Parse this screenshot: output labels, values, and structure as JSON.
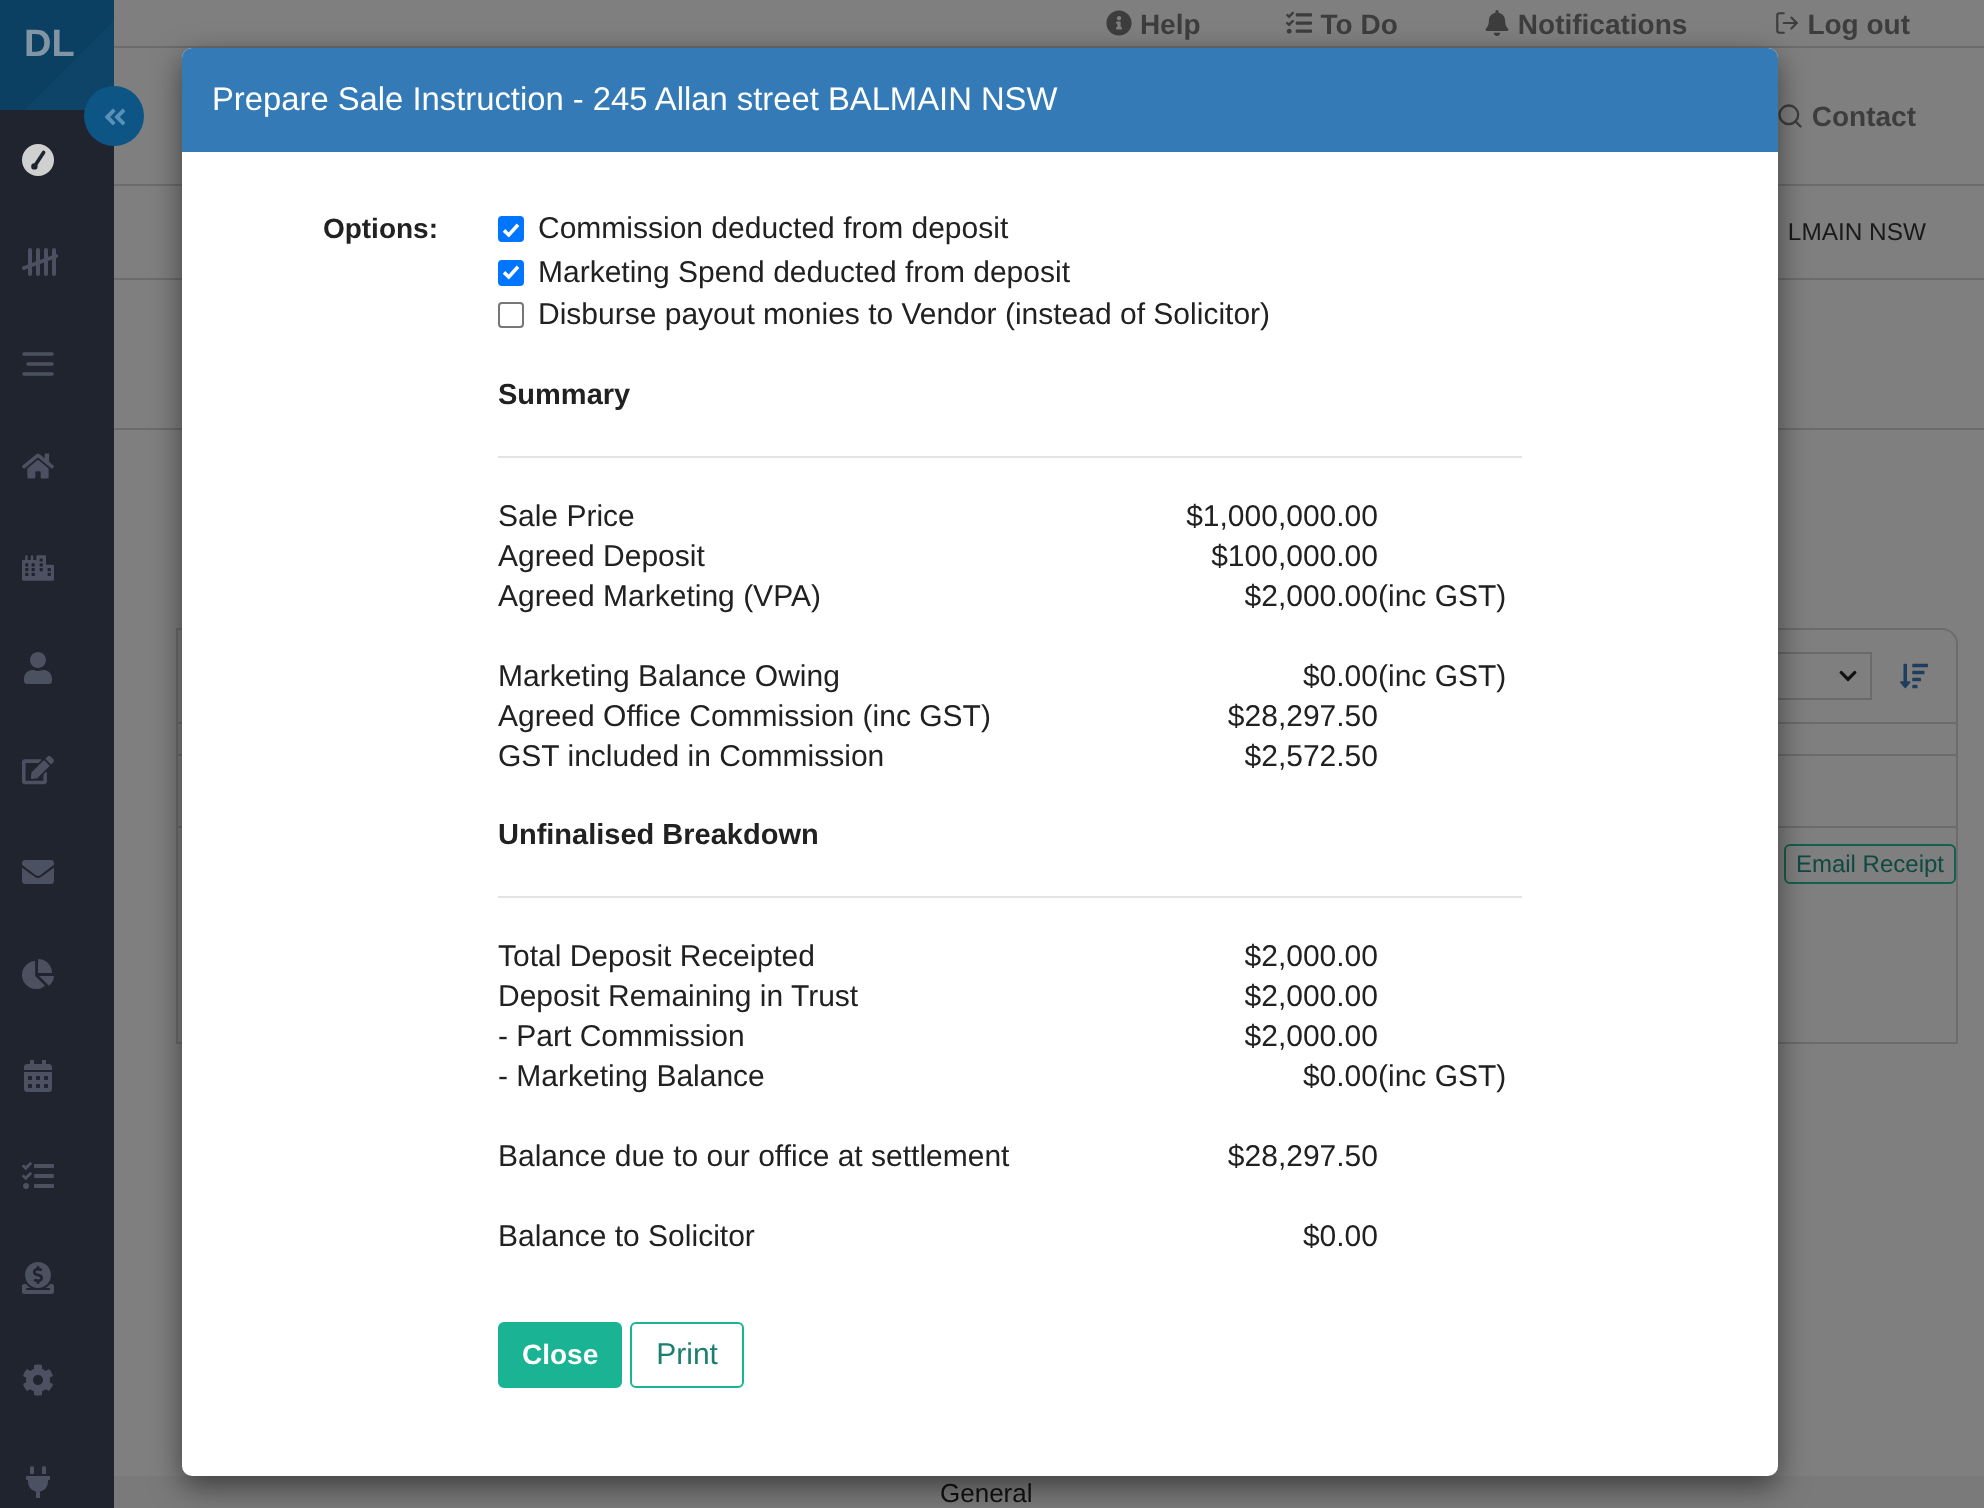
{
  "sidebar": {
    "logo": "DL",
    "items": [
      {
        "selected": true
      },
      {
        "selected": false
      },
      {
        "selected": false
      },
      {
        "selected": false
      },
      {
        "selected": false
      },
      {
        "selected": false
      },
      {
        "selected": false
      },
      {
        "selected": false
      },
      {
        "selected": false
      },
      {
        "selected": false
      },
      {
        "selected": false
      },
      {
        "selected": false
      },
      {
        "selected": false
      },
      {
        "selected": false
      }
    ]
  },
  "top_nav": [
    {
      "label": "Help"
    },
    {
      "label": "To Do"
    },
    {
      "label": "Notifications"
    },
    {
      "label": "Log out"
    }
  ],
  "search_link": {
    "label": "Contact"
  },
  "breadcrumb": "LMAIN NSW",
  "receipt_button": "Email Receipt",
  "bottom_tab": "General",
  "modal": {
    "title": "Prepare Sale Instruction - 245 Allan street BALMAIN NSW",
    "options_label": "Options:",
    "options": [
      {
        "label": "Commission deducted from deposit",
        "checked": true
      },
      {
        "label": "Marketing Spend deducted from deposit",
        "checked": true
      },
      {
        "label": "Disburse payout monies to Vendor (instead of Solicitor)",
        "checked": false
      }
    ],
    "sections": [
      {
        "heading": "Summary",
        "groups": [
          {
            "rows": [
              {
                "label": "Sale Price",
                "value": "$1,000,000.00"
              },
              {
                "label": "Agreed Deposit",
                "value": "$100,000.00"
              },
              {
                "label": "Agreed Marketing (VPA)",
                "value": "$2,000.00",
                "note": "(inc GST)"
              }
            ]
          },
          {
            "rows": [
              {
                "label": "Marketing Balance Owing",
                "value": "$0.00",
                "note": "(inc GST)"
              },
              {
                "label": "Agreed Office Commission (inc GST)",
                "value": "$28,297.50"
              },
              {
                "label": "GST included in Commission",
                "value": "$2,572.50"
              }
            ]
          }
        ]
      },
      {
        "heading": "Unfinalised Breakdown",
        "groups": [
          {
            "rows": [
              {
                "label": "Total Deposit Receipted",
                "value": "$2,000.00"
              },
              {
                "label": "Deposit Remaining in Trust",
                "value": "$2,000.00"
              },
              {
                "label": "- Part Commission",
                "value": "$2,000.00"
              },
              {
                "label": "- Marketing Balance",
                "value": "$0.00",
                "note": "(inc GST)"
              }
            ]
          },
          {
            "rows": [
              {
                "label": "Balance due to our office at settlement",
                "value": "$28,297.50"
              }
            ]
          },
          {
            "rows": [
              {
                "label": "Balance to Solicitor",
                "value": "$0.00"
              }
            ]
          }
        ]
      }
    ],
    "buttons": [
      {
        "label": "Close",
        "kind": "primary"
      },
      {
        "label": "Print",
        "kind": "outline"
      }
    ]
  }
}
